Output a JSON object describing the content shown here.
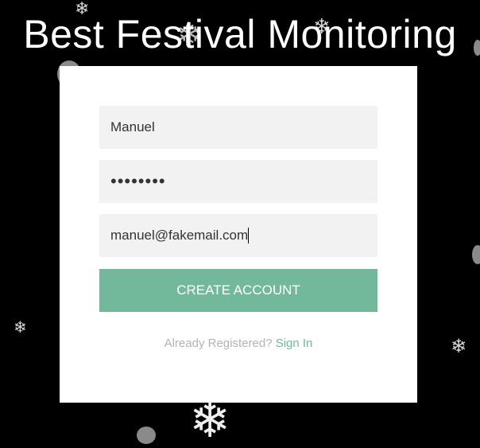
{
  "header": {
    "title": "Best Festival Monitoring"
  },
  "form": {
    "username_value": "Manuel",
    "password_value": "••••••••",
    "email_value": "manuel@fakemail.com",
    "create_button_label": "CREATE ACCOUNT",
    "already_registered_text": "Already Registered?",
    "sign_in_label": "Sign In"
  },
  "colors": {
    "background": "#000000",
    "card": "#ffffff",
    "input_bg": "#f2f2f2",
    "accent": "#72b99b",
    "muted_text": "#b3b3b3"
  },
  "decorations": {
    "icon": "snowflake-icon"
  }
}
